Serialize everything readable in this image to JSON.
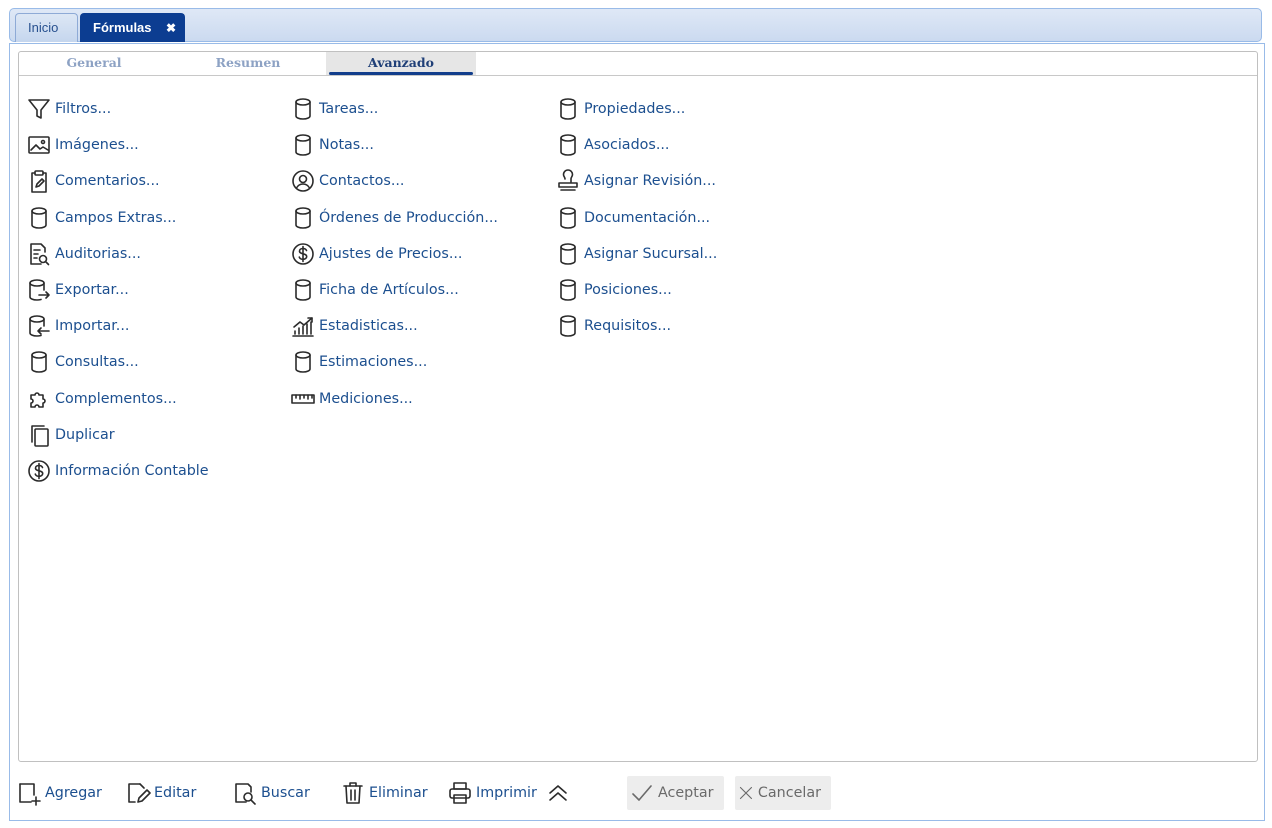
{
  "window_tabs": {
    "home": "Inicio",
    "active": "Fórmulas",
    "close_glyph": "✖"
  },
  "subtabs": {
    "general": "General",
    "resumen": "Resumen",
    "avanzado": "Avanzado"
  },
  "columns": [
    [
      {
        "label": "Filtros...",
        "icon": "filter-icon"
      },
      {
        "label": "Imágenes...",
        "icon": "image-icon"
      },
      {
        "label": "Comentarios...",
        "icon": "clipboard-edit-icon"
      },
      {
        "label": "Campos Extras...",
        "icon": "database-icon"
      },
      {
        "label": "Auditorias...",
        "icon": "document-search-icon"
      },
      {
        "label": "Exportar...",
        "icon": "database-export-icon"
      },
      {
        "label": "Importar...",
        "icon": "database-import-icon"
      },
      {
        "label": "Consultas...",
        "icon": "database-icon"
      },
      {
        "label": "Complementos...",
        "icon": "puzzle-icon"
      },
      {
        "label": "Duplicar",
        "icon": "copy-icon"
      },
      {
        "label": "Información Contable",
        "icon": "dollar-circle-icon"
      }
    ],
    [
      {
        "label": "Tareas...",
        "icon": "database-icon"
      },
      {
        "label": "Notas...",
        "icon": "database-icon"
      },
      {
        "label": "Contactos...",
        "icon": "user-circle-icon"
      },
      {
        "label": "Órdenes de Producción...",
        "icon": "database-icon"
      },
      {
        "label": "Ajustes de Precios...",
        "icon": "dollar-circle-icon"
      },
      {
        "label": "Ficha de Artículos...",
        "icon": "database-icon"
      },
      {
        "label": "Estadisticas...",
        "icon": "chart-growth-icon"
      },
      {
        "label": "Estimaciones...",
        "icon": "database-icon"
      },
      {
        "label": "Mediciones...",
        "icon": "ruler-icon"
      }
    ],
    [
      {
        "label": "Propiedades...",
        "icon": "database-icon"
      },
      {
        "label": "Asociados...",
        "icon": "database-icon"
      },
      {
        "label": "Asignar Revisión...",
        "icon": "stamp-icon"
      },
      {
        "label": "Documentación...",
        "icon": "database-icon"
      },
      {
        "label": "Asignar Sucursal...",
        "icon": "database-icon"
      },
      {
        "label": "Posiciones...",
        "icon": "database-icon"
      },
      {
        "label": "Requisitos...",
        "icon": "database-icon"
      }
    ]
  ],
  "toolbar": {
    "agregar": "Agregar",
    "editar": "Editar",
    "buscar": "Buscar",
    "eliminar": "Eliminar",
    "imprimir": "Imprimir",
    "aceptar": "Aceptar",
    "cancelar": "Cancelar"
  }
}
